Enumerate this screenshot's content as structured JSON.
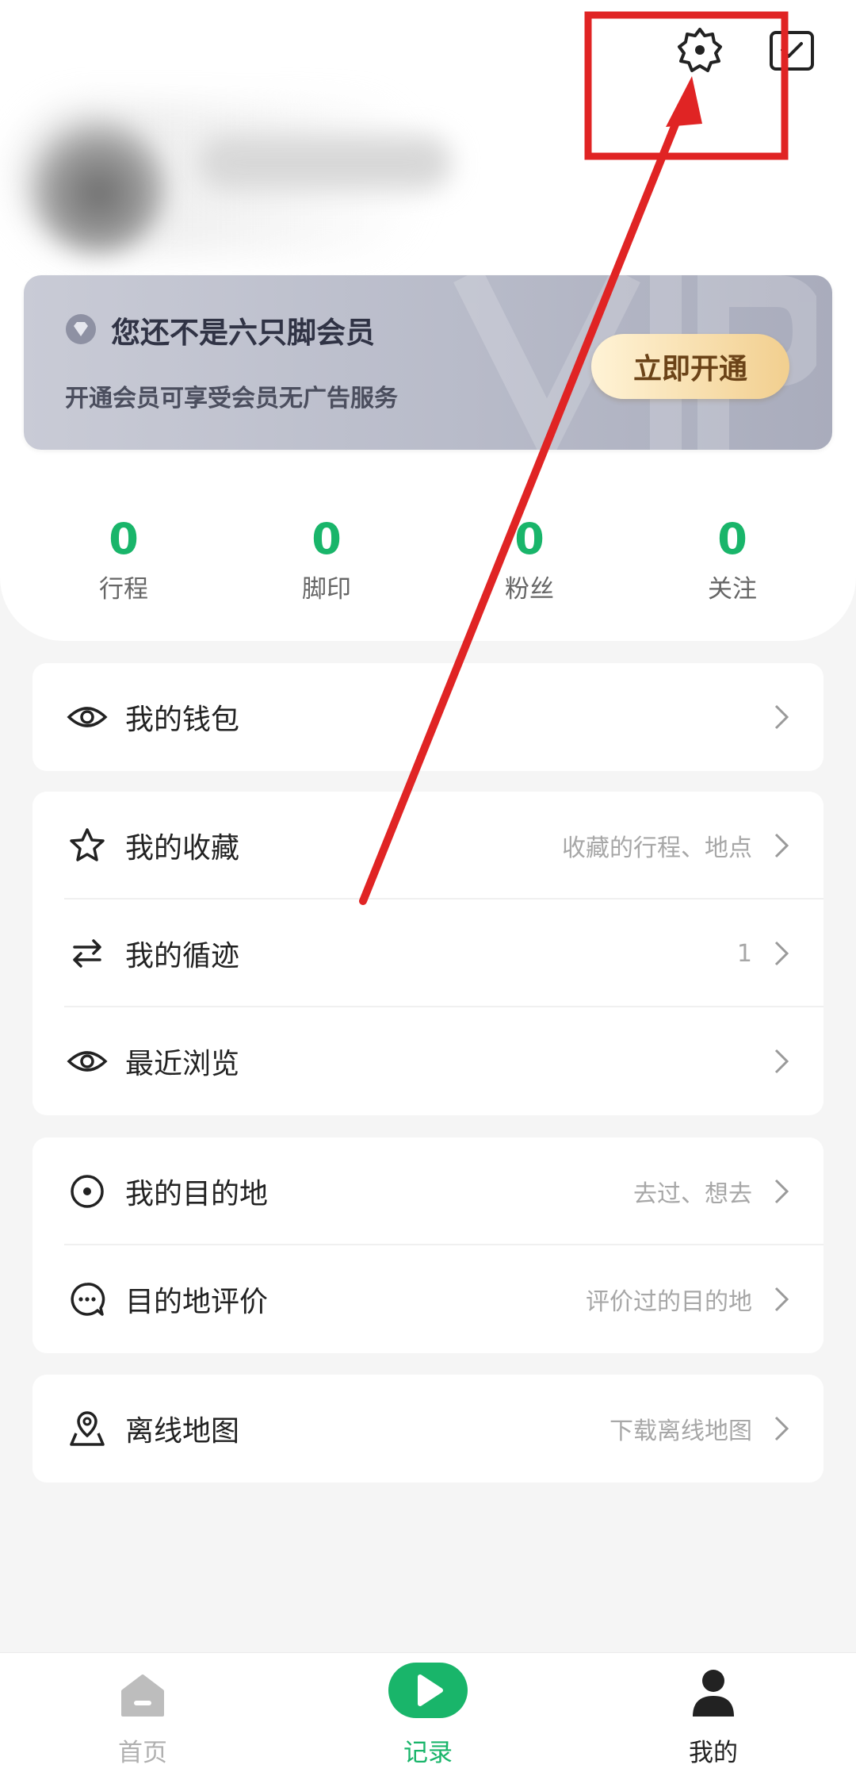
{
  "header": {
    "settings_icon": "settings-gear-icon",
    "checkin_icon": "check-in-icon"
  },
  "vip": {
    "title": "您还不是六只脚会员",
    "subtitle": "开通会员可享受会员无广告服务",
    "button": "立即开通"
  },
  "stats": [
    {
      "value": "0",
      "label": "行程"
    },
    {
      "value": "0",
      "label": "脚印"
    },
    {
      "value": "0",
      "label": "粉丝"
    },
    {
      "value": "0",
      "label": "关注"
    }
  ],
  "menu": {
    "wallet": {
      "label": "我的钱包",
      "hint": ""
    },
    "favorites": {
      "label": "我的收藏",
      "hint": "收藏的行程、地点"
    },
    "tracks": {
      "label": "我的循迹",
      "hint": "1"
    },
    "recent": {
      "label": "最近浏览",
      "hint": ""
    },
    "destinations": {
      "label": "我的目的地",
      "hint": "去过、想去"
    },
    "reviews": {
      "label": "目的地评价",
      "hint": "评价过的目的地"
    },
    "offline_map": {
      "label": "离线地图",
      "hint": "下载离线地图"
    }
  },
  "tabbar": {
    "home": "首页",
    "record": "记录",
    "mine": "我的"
  },
  "colors": {
    "accent": "#19b56a",
    "annotation": "#e02424"
  }
}
